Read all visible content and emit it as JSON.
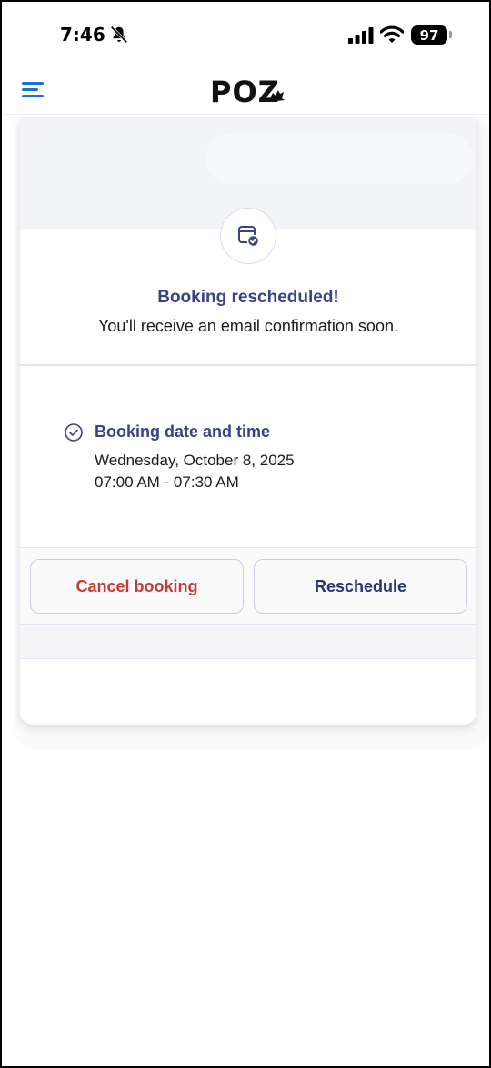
{
  "status_bar": {
    "time": "7:46",
    "battery": "97"
  },
  "header": {
    "logo": "POZ"
  },
  "confirmation": {
    "title": "Booking rescheduled!",
    "subtitle": "You'll receive an email confirmation soon."
  },
  "details": {
    "heading": "Booking date and time",
    "date": "Wednesday, October 8, 2025",
    "time_range": "07:00 AM - 07:30 AM"
  },
  "actions": {
    "cancel_label": "Cancel booking",
    "reschedule_label": "Reschedule"
  },
  "colors": {
    "accent": "#3a4289",
    "danger": "#c53a35",
    "menu": "#1a6fe8"
  },
  "icons": [
    "bell-off-icon",
    "signal-icon",
    "wifi-icon",
    "menu-icon",
    "calendar-check-icon",
    "check-circle-icon"
  ]
}
